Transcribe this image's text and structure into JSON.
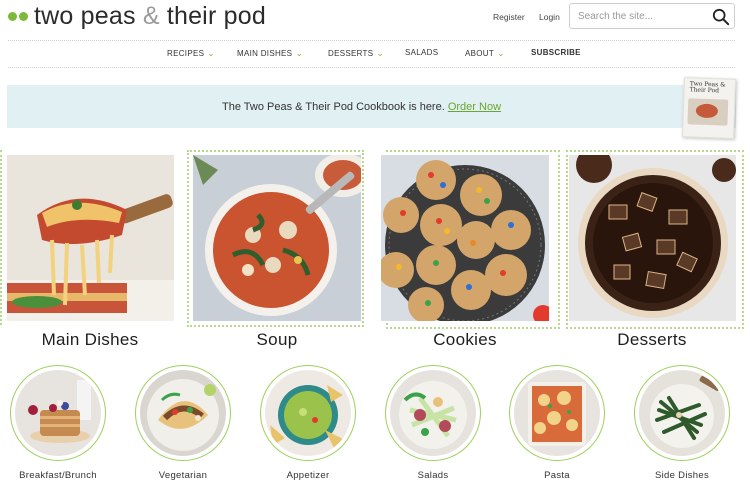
{
  "logo": {
    "word1": "two peas ",
    "amp": "&",
    "word2": " their pod"
  },
  "header": {
    "register": "Register",
    "login": "Login",
    "search_placeholder": "Search the site...",
    "icons": {
      "search": "search-icon"
    }
  },
  "nav": {
    "items": [
      {
        "label": "RECIPES",
        "chevron": "⌄"
      },
      {
        "label": "MAIN DISHES",
        "chevron": "⌄"
      },
      {
        "label": "DESSERTS",
        "chevron": "⌄"
      },
      {
        "label": "SALADS"
      },
      {
        "label": "ABOUT",
        "chevron": "⌄"
      },
      {
        "label": "SUBSCRIBE"
      }
    ]
  },
  "banner": {
    "text": "The Two Peas & Their Pod Cookbook is here. ",
    "link": "Order Now",
    "book_title": "Two Peas & Their Pod"
  },
  "categories": [
    {
      "label": "Main Dishes"
    },
    {
      "label": "Soup"
    },
    {
      "label": "Cookies"
    },
    {
      "label": "Desserts"
    }
  ],
  "circles": [
    {
      "label": "Breakfast/Brunch"
    },
    {
      "label": "Vegetarian"
    },
    {
      "label": "Appetizer"
    },
    {
      "label": "Salads"
    },
    {
      "label": "Pasta"
    },
    {
      "label": "Side Dishes"
    }
  ],
  "colors": {
    "accent": "#7dba3a",
    "banner_bg": "#e0f0f3",
    "link": "#6aa532"
  }
}
